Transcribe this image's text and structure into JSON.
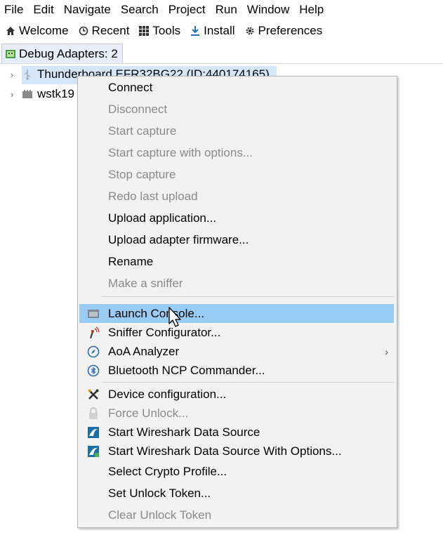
{
  "menubar": {
    "items": [
      "File",
      "Edit",
      "Navigate",
      "Search",
      "Project",
      "Run",
      "Window",
      "Help"
    ]
  },
  "toolbar": {
    "items": [
      {
        "label": "Welcome",
        "icon": "home-icon"
      },
      {
        "label": "Recent",
        "icon": "clock-icon"
      },
      {
        "label": "Tools",
        "icon": "grid-icon"
      },
      {
        "label": "Install",
        "icon": "download-icon"
      },
      {
        "label": "Preferences",
        "icon": "gear-icon"
      }
    ]
  },
  "view_tab": {
    "label": "Debug Adapters: 2"
  },
  "tree": {
    "rows": [
      {
        "label": "Thunderboard EFR32BG22 (ID:440174165)",
        "selected": true
      },
      {
        "label": "wstk19"
      }
    ]
  },
  "context_menu": {
    "items": [
      {
        "label": "Connect",
        "enabled": true
      },
      {
        "label": "Disconnect",
        "enabled": false
      },
      {
        "label": "Start capture",
        "enabled": false
      },
      {
        "label": "Start capture with options...",
        "enabled": false
      },
      {
        "label": "Stop capture",
        "enabled": false
      },
      {
        "label": "Redo last upload",
        "enabled": false
      },
      {
        "label": "Upload application...",
        "enabled": true
      },
      {
        "label": "Upload adapter firmware...",
        "enabled": true
      },
      {
        "label": "Rename",
        "enabled": true
      },
      {
        "label": "Make a sniffer",
        "enabled": false
      },
      {
        "label": "Launch Console...",
        "enabled": true,
        "hovered": true,
        "icon": "console-icon"
      },
      {
        "label": "Sniffer Configurator...",
        "enabled": true,
        "icon": "sniffer-icon"
      },
      {
        "label": "AoA Analyzer",
        "enabled": true,
        "icon": "compass-icon",
        "has_submenu": true
      },
      {
        "label": "Bluetooth NCP Commander...",
        "enabled": true,
        "icon": "bluetooth-icon"
      },
      {
        "label": "Device configuration...",
        "enabled": true,
        "icon": "tools-icon"
      },
      {
        "label": "Force Unlock...",
        "enabled": false,
        "icon": "lock-icon"
      },
      {
        "label": "Start Wireshark Data Source",
        "enabled": true,
        "icon": "wireshark-icon"
      },
      {
        "label": "Start Wireshark Data Source With Options...",
        "enabled": true,
        "icon": "wireshark-options-icon"
      },
      {
        "label": "Select Crypto Profile...",
        "enabled": true
      },
      {
        "label": "Set Unlock Token...",
        "enabled": true
      },
      {
        "label": "Clear Unlock Token",
        "enabled": false
      }
    ]
  },
  "colors": {
    "hover": "#99ccf5",
    "selection": "#d5e6f8",
    "disabled_text": "#8a8a8a",
    "menu_bg": "#f2f2f2"
  }
}
